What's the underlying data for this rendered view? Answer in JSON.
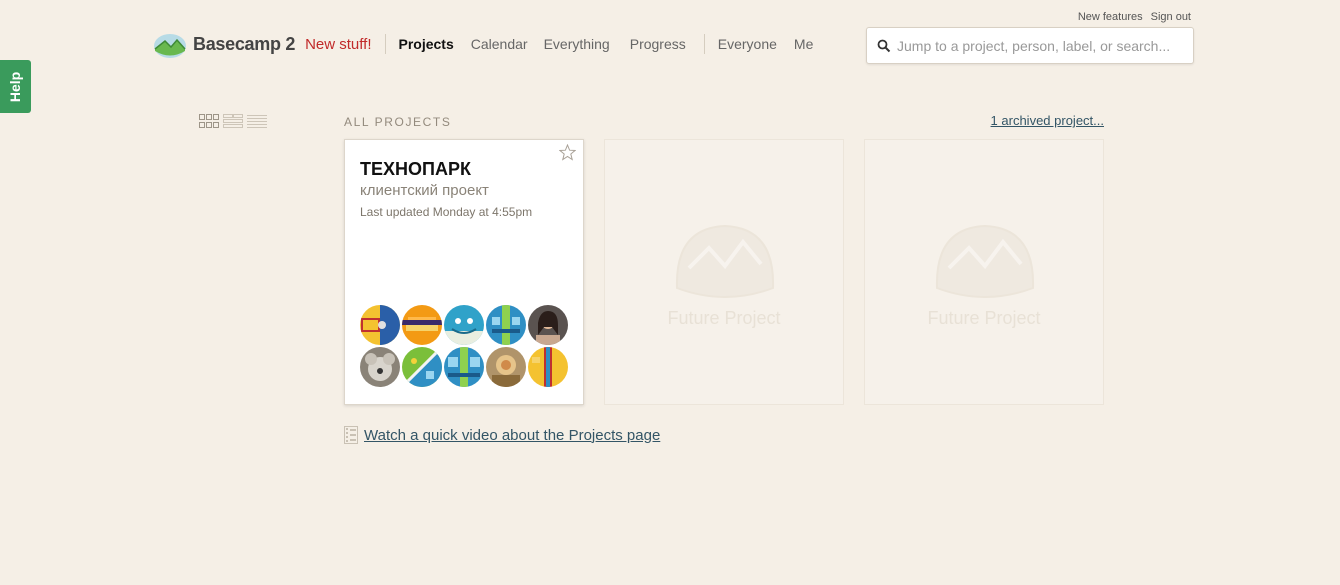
{
  "help": {
    "label": "Help"
  },
  "util_links": {
    "new_features": "New features",
    "sign_out": "Sign out"
  },
  "brand": {
    "name": "Basecamp",
    "version": "2",
    "new_stuff": "New stuff!"
  },
  "nav": {
    "primary": [
      "Projects",
      "Calendar",
      "Everything",
      "Progress"
    ],
    "secondary": [
      "Everyone",
      "Me"
    ],
    "active": "Projects"
  },
  "search": {
    "placeholder": "Jump to a project, person, label, or search..."
  },
  "projects": {
    "section_title": "ALL PROJECTS",
    "archived_link": "1 archived project...",
    "items": [
      {
        "title": "ТЕХНОПАРК",
        "subtitle": "клиентский проект",
        "updated": "Last updated Monday at 4:55pm",
        "starred": false,
        "avatar_count": 10
      }
    ],
    "placeholders": [
      "Future Project",
      "Future Project"
    ]
  },
  "video": {
    "label": "Watch a quick video about the Projects page"
  },
  "colors": {
    "background": "#f5efe6",
    "help_green": "#3a9b5c",
    "new_stuff_red": "#c12a2a",
    "link_blue": "#335566"
  }
}
